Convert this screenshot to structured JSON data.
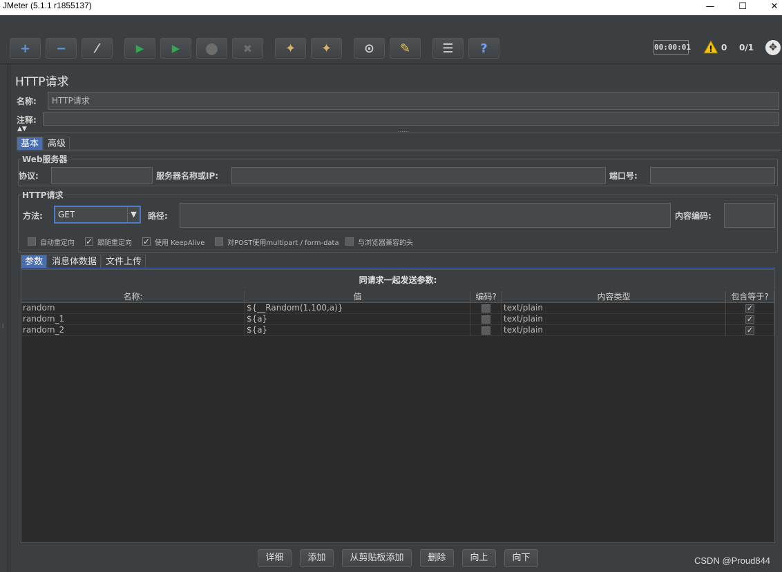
{
  "window": {
    "title": "JMeter (5.1.1 r1855137)",
    "minimize": "—",
    "maximize": "☐",
    "close": "✕"
  },
  "toolbar": {
    "buttons": [
      {
        "name": "add-button",
        "glyph": "+",
        "color": "#5a9bd5"
      },
      {
        "name": "remove-button",
        "glyph": "−",
        "color": "#5a9bd5"
      },
      {
        "name": "toggle-button",
        "glyph": "⁄",
        "color": "#cfcfcf"
      },
      {
        "name": "start-button",
        "glyph": "▶",
        "color": "#2fa84f"
      },
      {
        "name": "start-no-pauses-button",
        "glyph": "▶",
        "color": "#2fa84f"
      },
      {
        "name": "stop-button",
        "glyph": "●",
        "color": "#6d6d6d"
      },
      {
        "name": "shutdown-button",
        "glyph": "✖",
        "color": "#6d6d6d"
      },
      {
        "name": "clear-button",
        "glyph": "✦",
        "color": "#d9b36c"
      },
      {
        "name": "clear-all-button",
        "glyph": "✦",
        "color": "#d9b36c"
      },
      {
        "name": "search-button",
        "glyph": "⊙",
        "color": "#cfcfcf"
      },
      {
        "name": "reset-search-button",
        "glyph": "✎",
        "color": "#e8c547"
      },
      {
        "name": "function-helper-button",
        "glyph": "☰",
        "color": "#e0e0e0"
      },
      {
        "name": "help-button",
        "glyph": "?",
        "color": "#6fa0ff"
      }
    ],
    "timer": "00:00:01",
    "warning_count": "0",
    "threads": "0/1",
    "warning_icon": "warning-icon",
    "remote_icon": "remote-icon"
  },
  "panel": {
    "title": "HTTP请求",
    "name_label": "名称:",
    "name_value": "HTTP请求",
    "comment_label": "注释:",
    "comment_value": "",
    "tabs": [
      "基本",
      "高级"
    ],
    "web_server": {
      "legend": "Web服务器",
      "protocol_label": "协议:",
      "protocol_value": "",
      "server_label": "服务器名称或IP:",
      "server_value": "",
      "port_label": "端口号:",
      "port_value": ""
    },
    "http_request": {
      "legend": "HTTP请求",
      "method_label": "方法:",
      "method_value": "GET",
      "path_label": "路径:",
      "path_value": "",
      "encoding_label": "内容编码:",
      "encoding_value": ""
    },
    "options": [
      {
        "label": "自动重定向",
        "checked": false
      },
      {
        "label": "跟随重定向",
        "checked": true
      },
      {
        "label": "使用 KeepAlive",
        "checked": true
      },
      {
        "label": "对POST使用multipart / form-data",
        "checked": false
      },
      {
        "label": "与浏览器兼容的头",
        "checked": false
      }
    ],
    "sub_tabs": [
      "参数",
      "消息体数据",
      "文件上传"
    ],
    "table": {
      "caption": "同请求一起发送参数:",
      "headers": [
        "名称:",
        "值",
        "编码?",
        "内容类型",
        "包含等于?"
      ],
      "rows": [
        {
          "name": "random",
          "value": "${__Random(1,100,a)}",
          "encode": false,
          "content_type": "text/plain",
          "include_equals": true
        },
        {
          "name": "random_1",
          "value": "${a}",
          "encode": false,
          "content_type": "text/plain",
          "include_equals": true
        },
        {
          "name": "random_2",
          "value": "${a}",
          "encode": false,
          "content_type": "text/plain",
          "include_equals": true
        }
      ]
    },
    "buttons": [
      "详细",
      "添加",
      "从剪贴板添加",
      "删除",
      "向上",
      "向下"
    ]
  },
  "watermark": "CSDN @Proud844"
}
